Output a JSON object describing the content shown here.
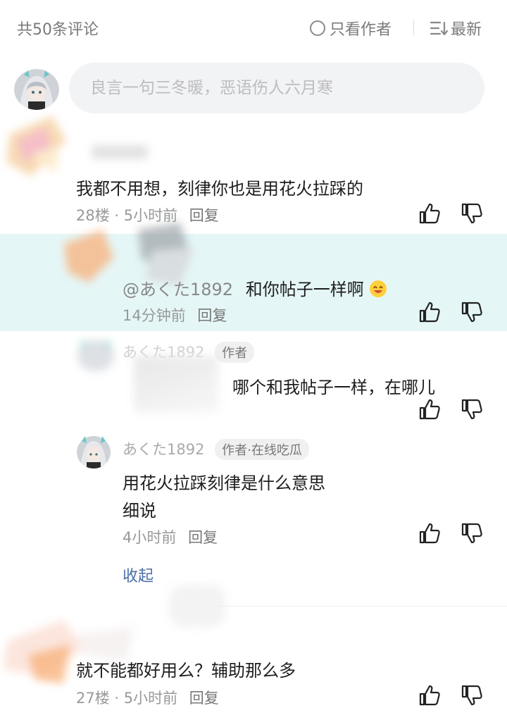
{
  "header": {
    "count": "共50条评论",
    "author_only": "只看作者",
    "sort": "最新"
  },
  "input": {
    "placeholder": "良言一句三冬暖，恶语伤人六月寒"
  },
  "comments": [
    {
      "text": "我都不用想，刻律你也是用花火拉踩的",
      "floor": "28楼 · 5小时前",
      "reply": "回复"
    },
    {
      "text": "就不能都好用么？辅助那么多",
      "floor": "27楼 · 5小时前",
      "reply": "回复"
    }
  ],
  "replies": [
    {
      "mention": "@あくた1892",
      "text": "和你帖子一样啊",
      "time": "14分钟前",
      "reply": "回复"
    },
    {
      "username": "あくた1892",
      "tag": "作者",
      "text": "哪个和我帖子一样，在哪儿"
    },
    {
      "username": "あくた1892",
      "tag": "作者·在线吃瓜",
      "text_line1": "用花火拉踩刻律是什么意思",
      "text_line2": "细说",
      "time": "4小时前",
      "reply": "回复"
    }
  ],
  "collapse_label": "收起",
  "colors": {
    "highlight": "#e5f6f6",
    "muted_text": "#999999",
    "link": "#4a6fa5"
  },
  "icons": [
    "circle-icon",
    "sort-lines-icon",
    "thumbs-up-icon",
    "thumbs-down-icon",
    "emoji-icon"
  ]
}
